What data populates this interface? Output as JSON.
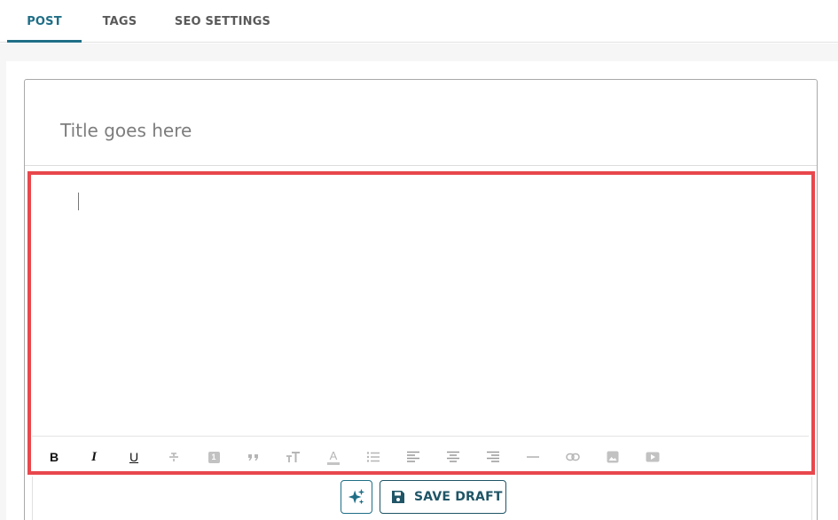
{
  "tabs": [
    {
      "label": "POST",
      "active": true
    },
    {
      "label": "TAGS",
      "active": false
    },
    {
      "label": "SEO SETTINGS",
      "active": false
    }
  ],
  "editor": {
    "title_placeholder": "Title goes here",
    "title_value": "",
    "body_value": ""
  },
  "toolbar": {
    "items": [
      {
        "name": "bold",
        "glyph": "B",
        "enabled": true
      },
      {
        "name": "italic",
        "glyph": "I",
        "enabled": true
      },
      {
        "name": "underline",
        "glyph": "U",
        "enabled": true
      },
      {
        "name": "strikethrough",
        "enabled": false
      },
      {
        "name": "numbered-heading",
        "glyph": "1",
        "enabled": false
      },
      {
        "name": "blockquote",
        "enabled": false
      },
      {
        "name": "font-size",
        "enabled": false
      },
      {
        "name": "text-color",
        "glyph": "A",
        "enabled": false
      },
      {
        "name": "bullet-list",
        "enabled": false
      },
      {
        "name": "align-left",
        "enabled": false
      },
      {
        "name": "align-center",
        "enabled": false
      },
      {
        "name": "align-right",
        "enabled": false
      },
      {
        "name": "horizontal-rule",
        "enabled": false
      },
      {
        "name": "link",
        "enabled": false
      },
      {
        "name": "image",
        "enabled": false
      },
      {
        "name": "video",
        "enabled": false
      }
    ]
  },
  "actions": {
    "ai_icon": "sparkles-icon",
    "save_icon": "floppy-disk-icon",
    "save_label": "SAVE DRAFT"
  },
  "colors": {
    "accent": "#1f6e86",
    "save_text": "#1f5566",
    "highlight": "#e8474c",
    "disabled_icon": "#b5b5b5"
  }
}
